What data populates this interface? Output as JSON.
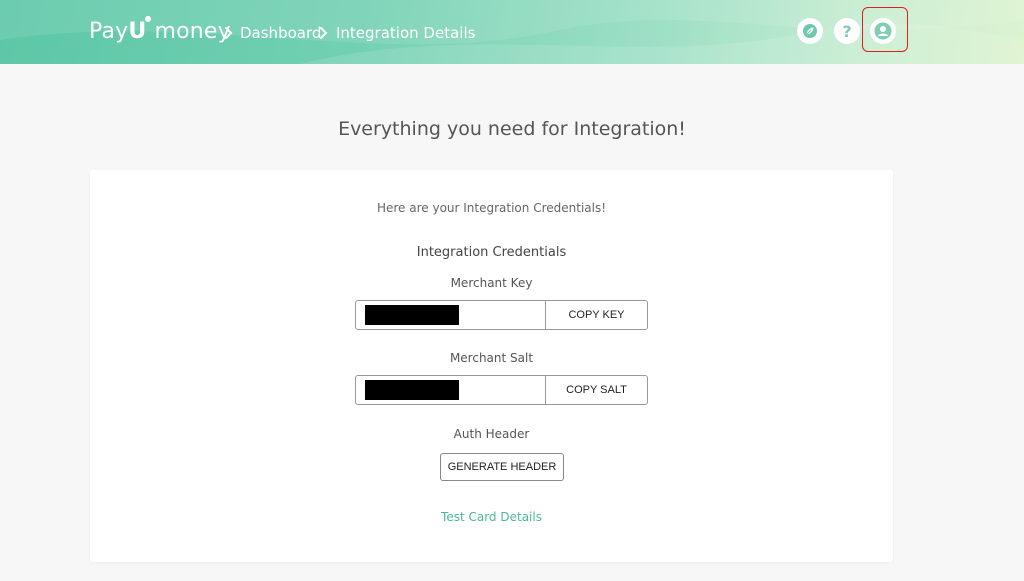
{
  "header": {
    "logo_payu": "Pay",
    "logo_u": "U",
    "logo_money": "money",
    "breadcrumb": [
      {
        "label": "Dashboard"
      },
      {
        "label": "Integration Details"
      }
    ],
    "icons": [
      "leaf-icon",
      "help-icon",
      "profile-icon"
    ],
    "help_glyph": "?"
  },
  "main": {
    "title": "Everything you need for Integration!",
    "intro": "Here are your Integration Credentials!",
    "credentials_title": "Integration Credentials",
    "merchant_key_label": "Merchant Key",
    "copy_key_label": "COPY KEY",
    "merchant_salt_label": "Merchant Salt",
    "copy_salt_label": "COPY SALT",
    "auth_header_label": "Auth Header",
    "generate_header_label": "GENERATE HEADER",
    "test_card_link": "Test Card Details"
  },
  "colors": {
    "header_start": "#5cc7a6",
    "header_end": "#ddf3cf",
    "link": "#4cb89a",
    "highlight": "#e02020"
  }
}
